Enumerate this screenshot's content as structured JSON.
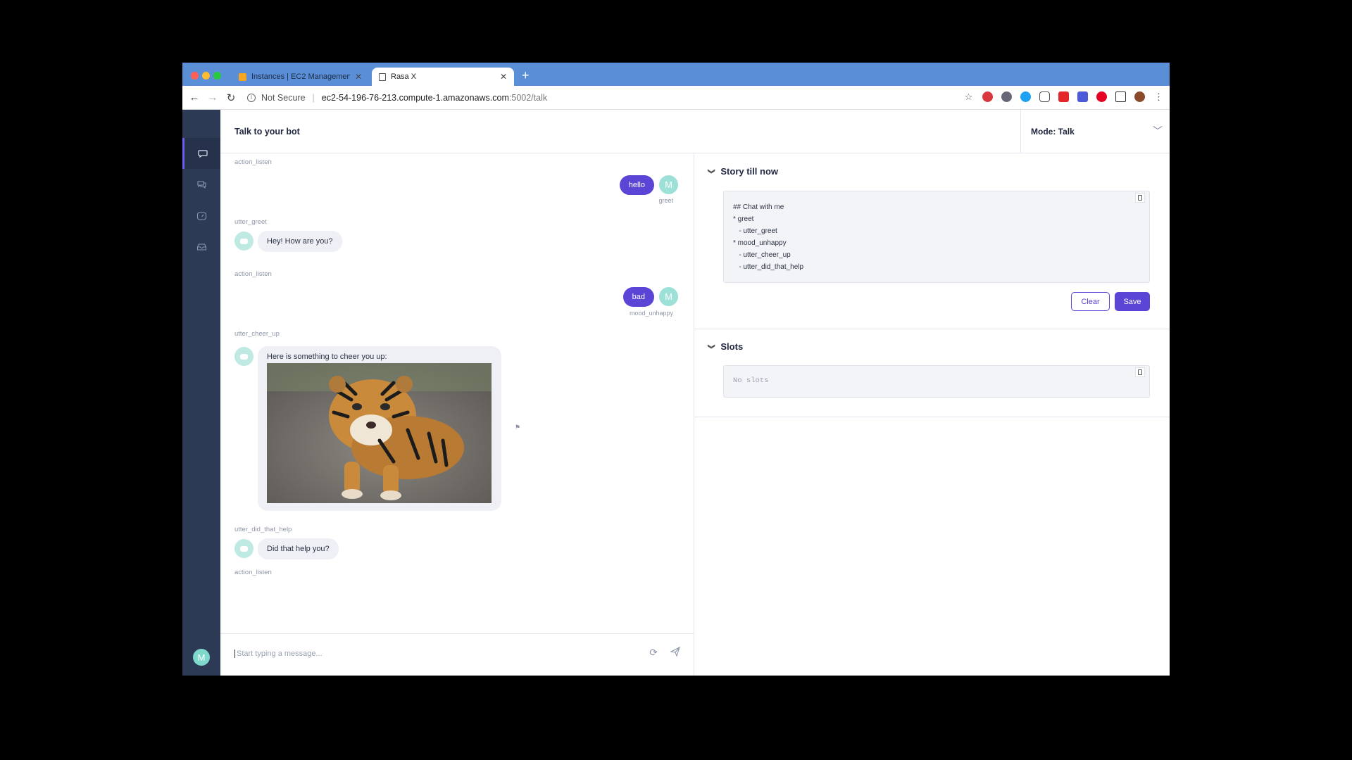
{
  "browser": {
    "tabs": [
      {
        "title": "Instances | EC2 Management C",
        "icon": "aws-icon"
      },
      {
        "title": "Rasa X",
        "icon": "document-icon"
      }
    ],
    "address": {
      "security": "Not Secure",
      "host": "ec2-54-196-76-213.compute-1.amazonaws.com",
      "path": ":5002/talk"
    }
  },
  "sidebar": {
    "items": [
      "talk-icon",
      "conversations-icon",
      "dashboard-icon",
      "inbox-icon"
    ],
    "avatar_letter": "M"
  },
  "header": {
    "title": "Talk to your bot",
    "mode": "Mode: Talk"
  },
  "chat": {
    "action_listen_1": "action_listen",
    "user_msg_1": "hello",
    "user_avatar": "M",
    "intent_1": "greet",
    "action_greet": "utter_greet",
    "bot_msg_1": "Hey! How are you?",
    "action_listen_2": "action_listen",
    "user_msg_2": "bad",
    "intent_2": "mood_unhappy",
    "action_cheer": "utter_cheer_up",
    "bot_card_text": "Here is something to cheer you up:",
    "action_help": "utter_did_that_help",
    "bot_msg_2": "Did that help you?",
    "action_listen_3": "action_listen",
    "input_placeholder": "Start typing a message..."
  },
  "story": {
    "title": "Story till now",
    "lines": "## Chat with me\n* greet\n   - utter_greet\n* mood_unhappy\n   - utter_cheer_up\n   - utter_did_that_help",
    "clear_label": "Clear",
    "save_label": "Save"
  },
  "slots": {
    "title": "Slots",
    "empty_text": "No slots"
  },
  "colors": {
    "accent": "#5a45d6",
    "sidebar": "#2c3a56",
    "browser_chrome": "#5a8fd8"
  }
}
